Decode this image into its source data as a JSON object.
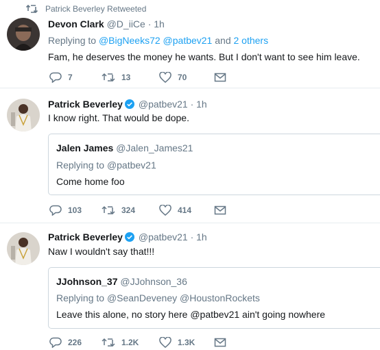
{
  "retweet_banner": {
    "text": "Patrick Beverley Retweeted",
    "icon": "retweet-icon"
  },
  "colors": {
    "accent": "#1da1f2",
    "muted": "#657786",
    "border": "#e6ecf0",
    "text": "#14171a"
  },
  "tweets": [
    {
      "name": "Devon Clark",
      "handle": "@D_iiCe",
      "time": "· 1h",
      "verified": false,
      "replying_prefix": "Replying to",
      "replying_links": "@BigNeeks72 @patbev21",
      "replying_suffix_and": "and",
      "replying_others": "2 others",
      "text": "Fam, he deserves the money he wants. But I don't want to see him leave.",
      "replies": "7",
      "retweets": "13",
      "likes": "70"
    },
    {
      "name": "Patrick Beverley",
      "handle": "@patbev21",
      "time": "· 1h",
      "verified": true,
      "text": "I know right. That would be dope.",
      "quote": {
        "name": "Jalen James",
        "handle": "@Jalen_James21",
        "replying_prefix": "Replying to",
        "replying_links": "@patbev21",
        "text": "Come home foo"
      },
      "replies": "103",
      "retweets": "324",
      "likes": "414"
    },
    {
      "name": "Patrick Beverley",
      "handle": "@patbev21",
      "time": "· 1h",
      "verified": true,
      "text": "Naw I wouldn't say that!!!",
      "quote": {
        "name": "JJohnson_37",
        "handle": "@JJohnson_36",
        "replying_prefix": "Replying to",
        "replying_links": "@SeanDeveney @HoustonRockets",
        "text": "Leave this alone, no story here @patbev21 ain't going nowhere"
      },
      "replies": "226",
      "retweets": "1.2K",
      "likes": "1.3K"
    }
  ]
}
